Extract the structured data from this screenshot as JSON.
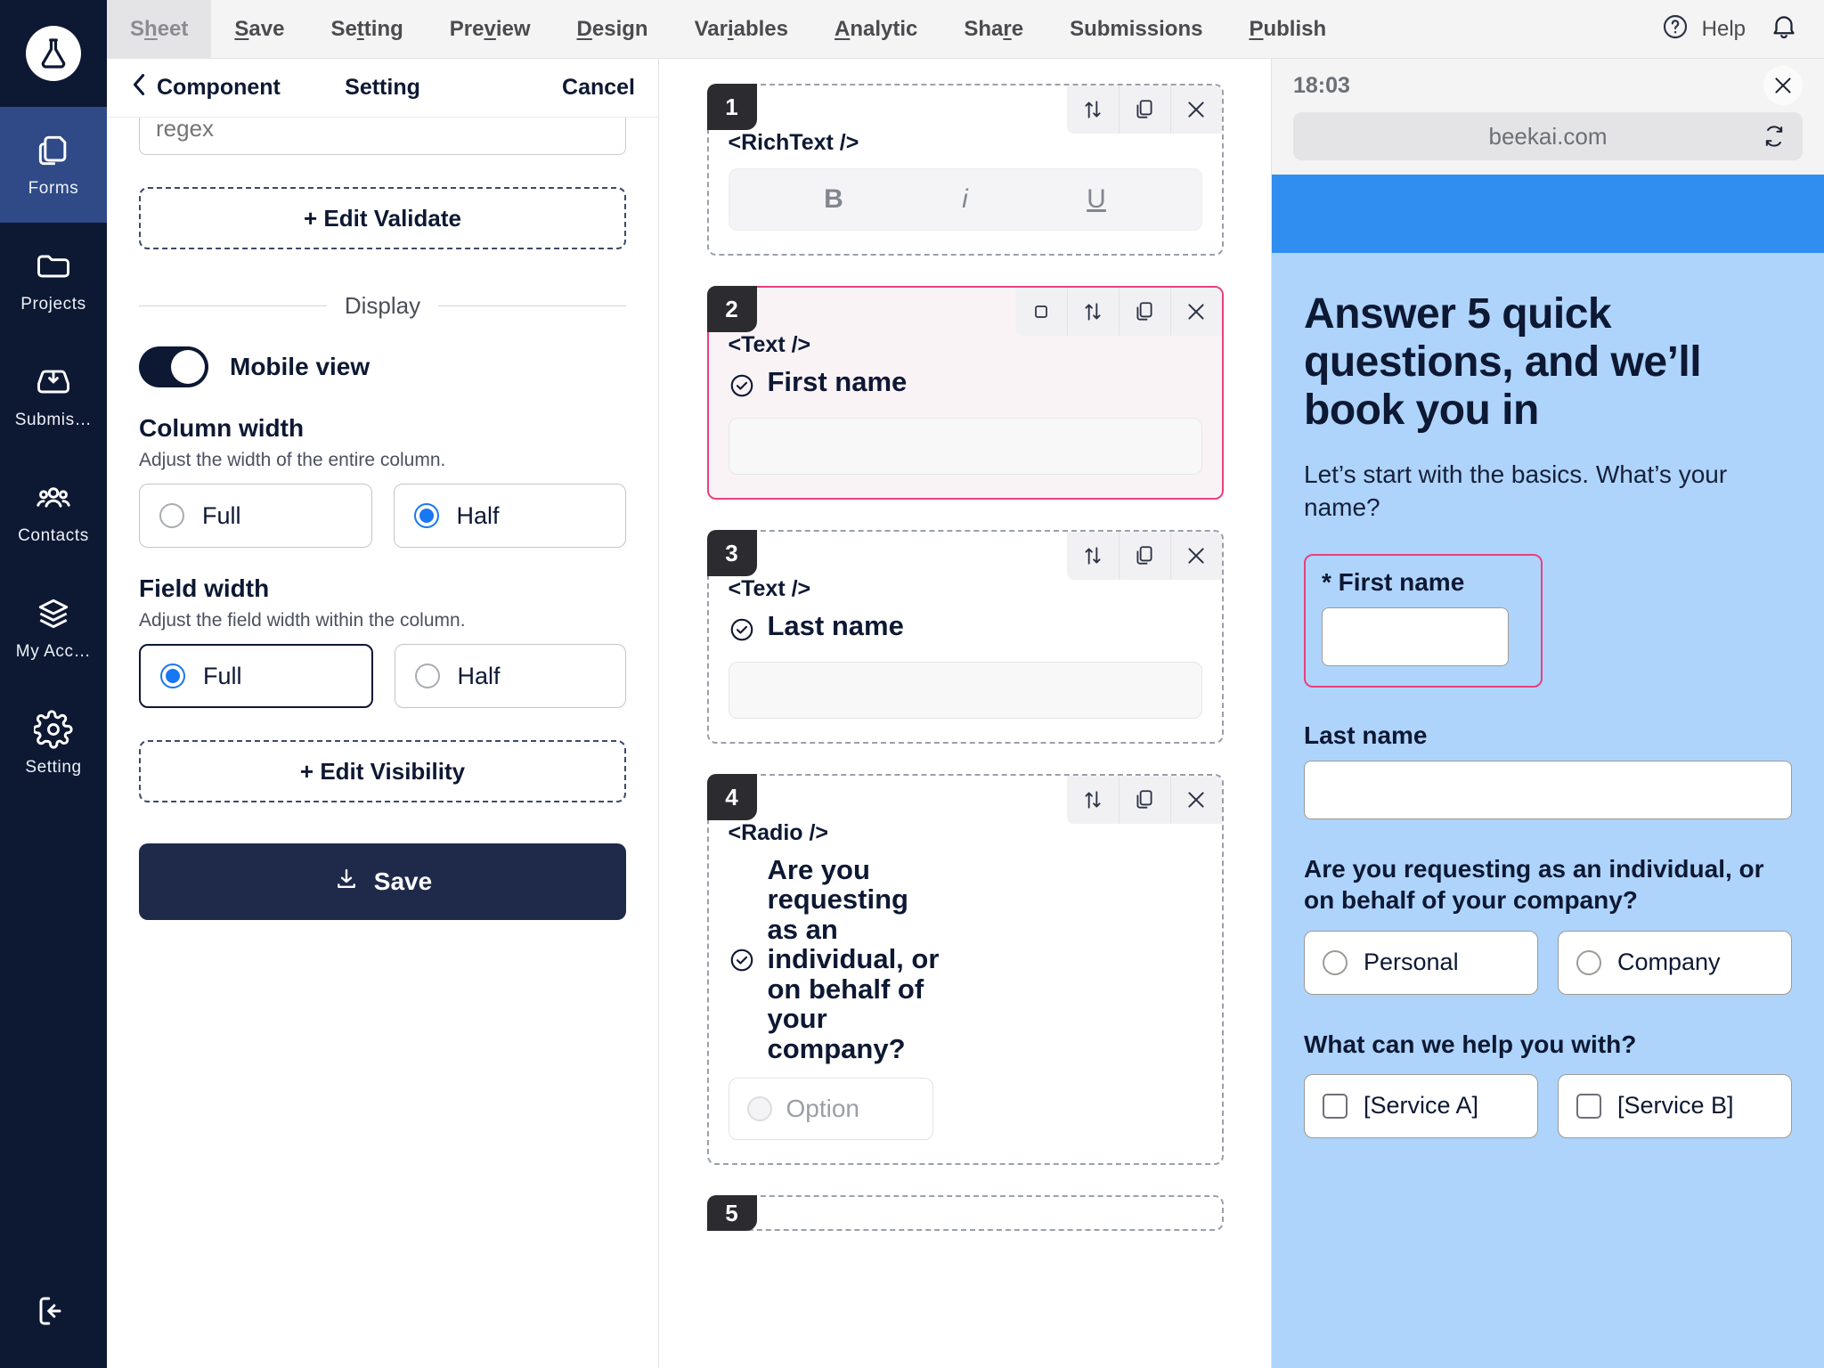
{
  "rail": {
    "logo_icon": "flask-logo-icon",
    "items": [
      {
        "label": "Forms",
        "icon": "forms-icon",
        "active": true
      },
      {
        "label": "Projects",
        "icon": "folder-icon",
        "active": false
      },
      {
        "label": "Submis…",
        "icon": "inbox-down-icon",
        "active": false
      },
      {
        "label": "Contacts",
        "icon": "people-icon",
        "active": false
      },
      {
        "label": "My Acc…",
        "icon": "layers-icon",
        "active": false
      },
      {
        "label": "Setting",
        "icon": "gear-icon",
        "active": false
      }
    ],
    "logout_icon": "logout-icon"
  },
  "topnav": {
    "tabs": [
      {
        "label": "Sheet",
        "accel": "h",
        "selected": true
      },
      {
        "label": "Save",
        "accel": "S",
        "selected": false
      },
      {
        "label": "Setting",
        "accel": "t",
        "selected": false
      },
      {
        "label": "Preview",
        "accel": "v",
        "selected": false
      },
      {
        "label": "Design",
        "accel": "D",
        "selected": false
      },
      {
        "label": "Variables",
        "accel": "i",
        "selected": false
      },
      {
        "label": "Analytic",
        "accel": "A",
        "selected": false
      },
      {
        "label": "Share",
        "accel": "r",
        "selected": false
      },
      {
        "label": "Submissions",
        "accel": "",
        "selected": false
      },
      {
        "label": "Publish",
        "accel": "P",
        "selected": false
      }
    ],
    "help_label": "Help",
    "help_icon": "question-circle-icon",
    "bell_icon": "bell-icon"
  },
  "settings": {
    "back_label": "Component",
    "back_icon": "chevron-left-icon",
    "title": "Setting",
    "cancel_label": "Cancel",
    "regex_placeholder": "regex",
    "regex_value": "",
    "edit_validate_label": "+ Edit Validate",
    "display_section_label": "Display",
    "mobile_view_label": "Mobile view",
    "mobile_view_on": true,
    "column_width": {
      "title": "Column width",
      "desc": "Adjust the width of the entire column.",
      "options": [
        {
          "label": "Full",
          "selected": false
        },
        {
          "label": "Half",
          "selected": true
        }
      ]
    },
    "field_width": {
      "title": "Field width",
      "desc": "Adjust the field width within the column.",
      "options": [
        {
          "label": "Full",
          "selected": true
        },
        {
          "label": "Half",
          "selected": false
        }
      ]
    },
    "edit_visibility_label": "+ Edit Visibility",
    "save_label": "Save",
    "save_icon": "download-icon"
  },
  "canvas": {
    "blocks": [
      {
        "number": "1",
        "tag": "<RichText />",
        "label": "",
        "selected": false,
        "tools": [
          "reorder-icon",
          "duplicate-icon",
          "delete-icon"
        ],
        "toolbar": {
          "bold": "B",
          "italic": "i",
          "underline": "U"
        }
      },
      {
        "number": "2",
        "tag": "<Text />",
        "label": "First name",
        "selected": true,
        "tools": [
          "resize-icon",
          "reorder-icon",
          "duplicate-icon",
          "delete-icon"
        ]
      },
      {
        "number": "3",
        "tag": "<Text />",
        "label": "Last name",
        "selected": false,
        "tools": [
          "reorder-icon",
          "duplicate-icon",
          "delete-icon"
        ]
      },
      {
        "number": "4",
        "tag": "<Radio />",
        "label": "Are you requesting as an individual, or on behalf of your company?",
        "selected": false,
        "tools": [
          "reorder-icon",
          "duplicate-icon",
          "delete-icon"
        ],
        "option_label": "Option"
      },
      {
        "number": "5",
        "tag": "",
        "label": "",
        "selected": false,
        "tools": []
      }
    ]
  },
  "preview": {
    "time": "18:03",
    "close_icon": "close-icon",
    "url": "beekai.com",
    "refresh_icon": "refresh-icon",
    "accent_bar_color": "#2f8ef0",
    "form_bg_color": "#aed4fb",
    "highlight_color": "#e8417f",
    "title": "Answer 5 quick questions, and we’ll book you in",
    "subtitle": "Let’s start with the basics. What’s your name?",
    "first_name_label": "* First name",
    "last_name_label": "Last name",
    "question_1": "Are you requesting as an individual, or on behalf of your company?",
    "question_1_options": [
      {
        "label": "Personal",
        "type": "radio",
        "checked": false
      },
      {
        "label": "Company",
        "type": "radio",
        "checked": false
      }
    ],
    "question_2": "What can we help you with?",
    "question_2_options": [
      {
        "label": "[Service A]",
        "type": "checkbox",
        "checked": false
      },
      {
        "label": "[Service B]",
        "type": "checkbox",
        "checked": false
      }
    ]
  }
}
